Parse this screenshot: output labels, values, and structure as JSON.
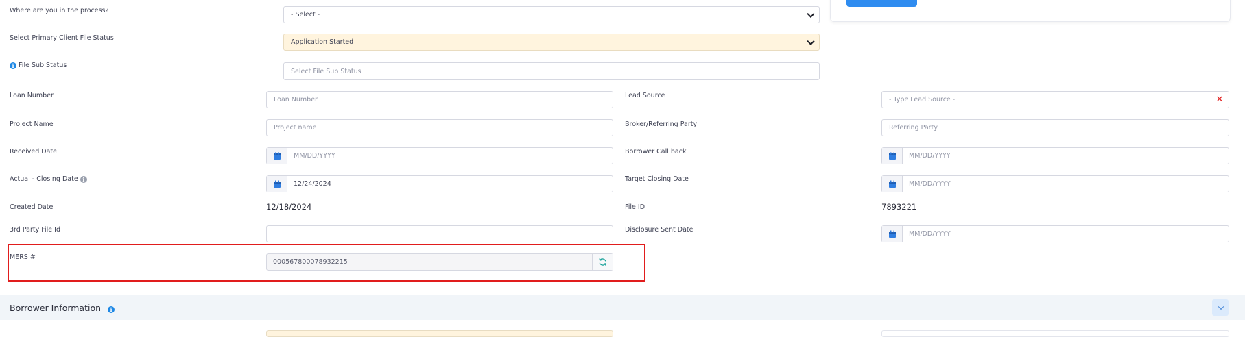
{
  "top_card": {},
  "process": {
    "label": "Where are you in the process?",
    "value": "- Select -"
  },
  "client_status": {
    "label": "Select Primary Client File Status",
    "value": "Application Started"
  },
  "sub_status": {
    "label": "File Sub Status",
    "placeholder": "Select File Sub Status"
  },
  "loan_number": {
    "label": "Loan Number",
    "placeholder": "Loan Number"
  },
  "lead_source": {
    "label": "Lead Source",
    "placeholder": "- Type Lead Source -",
    "clear_glyph": "✕"
  },
  "project_name": {
    "label": "Project Name",
    "placeholder": "Project name"
  },
  "broker": {
    "label": "Broker/Referring Party",
    "placeholder": "Referring Party"
  },
  "received_date": {
    "label": "Received Date",
    "placeholder": "MM/DD/YYYY"
  },
  "borrower_callback": {
    "label": "Borrower Call back",
    "placeholder": "MM/DD/YYYY"
  },
  "actual_closing": {
    "label": "Actual - Closing Date",
    "value": "12/24/2024"
  },
  "target_closing": {
    "label": "Target Closing Date",
    "placeholder": "MM/DD/YYYY"
  },
  "created_date": {
    "label": "Created Date",
    "value": "12/18/2024"
  },
  "file_id": {
    "label": "File ID",
    "value": "7893221"
  },
  "third_party": {
    "label": "3rd Party File Id",
    "value": ""
  },
  "disclosure_sent": {
    "label": "Disclosure Sent Date",
    "placeholder": "MM/DD/YYYY"
  },
  "mers": {
    "label": "MERS #",
    "value": "000567800078932215"
  },
  "borrower_section": {
    "title": "Borrower Information"
  },
  "colors": {
    "accent": "#2f8cf0",
    "highlight": "#e11d1d",
    "warm_select": "#fff4de",
    "teal_icon": "#1aa29a"
  }
}
